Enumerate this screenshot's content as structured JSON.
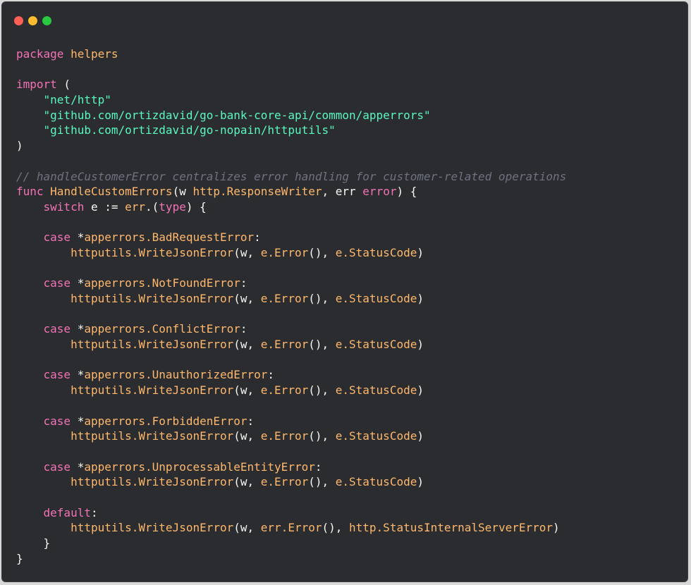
{
  "window": {
    "controls": [
      {
        "name": "close",
        "color": "#ff5f57"
      },
      {
        "name": "minimize",
        "color": "#febc2e"
      },
      {
        "name": "maximize",
        "color": "#28c840"
      }
    ]
  },
  "colors": {
    "background": "#2a2c30",
    "keyword": "#f472b6",
    "identifier": "#ffb86c",
    "string": "#5af7c2",
    "comment": "#6f7280",
    "plain": "#f8f8f2"
  },
  "code": {
    "language": "go",
    "lines": [
      [
        {
          "t": "package",
          "k": "keyword"
        },
        {
          "t": " ",
          "k": "plain"
        },
        {
          "t": "helpers",
          "k": "ident"
        }
      ],
      [],
      [
        {
          "t": "import",
          "k": "keyword"
        },
        {
          "t": " (",
          "k": "plain"
        }
      ],
      [
        {
          "t": "    ",
          "k": "plain"
        },
        {
          "t": "\"net/http\"",
          "k": "string"
        }
      ],
      [
        {
          "t": "    ",
          "k": "plain"
        },
        {
          "t": "\"github.com/ortizdavid/go-bank-core-api/common/apperrors\"",
          "k": "string"
        }
      ],
      [
        {
          "t": "    ",
          "k": "plain"
        },
        {
          "t": "\"github.com/ortizdavid/go-nopain/httputils\"",
          "k": "string"
        }
      ],
      [
        {
          "t": ")",
          "k": "plain"
        }
      ],
      [],
      [
        {
          "t": "// handleCustomerError centralizes error handling for customer-related operations",
          "k": "comment"
        }
      ],
      [
        {
          "t": "func",
          "k": "keyword"
        },
        {
          "t": " ",
          "k": "plain"
        },
        {
          "t": "HandleCustomErrors",
          "k": "ident"
        },
        {
          "t": "(w ",
          "k": "plain"
        },
        {
          "t": "http.ResponseWriter",
          "k": "ident"
        },
        {
          "t": ", err ",
          "k": "plain"
        },
        {
          "t": "error",
          "k": "keyword"
        },
        {
          "t": ") {",
          "k": "plain"
        }
      ],
      [
        {
          "t": "    ",
          "k": "plain"
        },
        {
          "t": "switch",
          "k": "keyword"
        },
        {
          "t": " e := ",
          "k": "plain"
        },
        {
          "t": "err",
          "k": "ident"
        },
        {
          "t": ".(",
          "k": "plain"
        },
        {
          "t": "type",
          "k": "keyword"
        },
        {
          "t": ") {",
          "k": "plain"
        }
      ],
      [],
      [
        {
          "t": "    ",
          "k": "plain"
        },
        {
          "t": "case",
          "k": "keyword"
        },
        {
          "t": " *",
          "k": "plain"
        },
        {
          "t": "apperrors.BadRequestError",
          "k": "ident"
        },
        {
          "t": ":",
          "k": "plain"
        }
      ],
      [
        {
          "t": "        ",
          "k": "plain"
        },
        {
          "t": "httputils.WriteJsonError",
          "k": "ident"
        },
        {
          "t": "(w, ",
          "k": "plain"
        },
        {
          "t": "e.Error",
          "k": "ident"
        },
        {
          "t": "(), ",
          "k": "plain"
        },
        {
          "t": "e.StatusCode",
          "k": "ident"
        },
        {
          "t": ")",
          "k": "plain"
        }
      ],
      [],
      [
        {
          "t": "    ",
          "k": "plain"
        },
        {
          "t": "case",
          "k": "keyword"
        },
        {
          "t": " *",
          "k": "plain"
        },
        {
          "t": "apperrors.NotFoundError",
          "k": "ident"
        },
        {
          "t": ":",
          "k": "plain"
        }
      ],
      [
        {
          "t": "        ",
          "k": "plain"
        },
        {
          "t": "httputils.WriteJsonError",
          "k": "ident"
        },
        {
          "t": "(w, ",
          "k": "plain"
        },
        {
          "t": "e.Error",
          "k": "ident"
        },
        {
          "t": "(), ",
          "k": "plain"
        },
        {
          "t": "e.StatusCode",
          "k": "ident"
        },
        {
          "t": ")",
          "k": "plain"
        }
      ],
      [],
      [
        {
          "t": "    ",
          "k": "plain"
        },
        {
          "t": "case",
          "k": "keyword"
        },
        {
          "t": " *",
          "k": "plain"
        },
        {
          "t": "apperrors.ConflictError",
          "k": "ident"
        },
        {
          "t": ":",
          "k": "plain"
        }
      ],
      [
        {
          "t": "        ",
          "k": "plain"
        },
        {
          "t": "httputils.WriteJsonError",
          "k": "ident"
        },
        {
          "t": "(w, ",
          "k": "plain"
        },
        {
          "t": "e.Error",
          "k": "ident"
        },
        {
          "t": "(), ",
          "k": "plain"
        },
        {
          "t": "e.StatusCode",
          "k": "ident"
        },
        {
          "t": ")",
          "k": "plain"
        }
      ],
      [],
      [
        {
          "t": "    ",
          "k": "plain"
        },
        {
          "t": "case",
          "k": "keyword"
        },
        {
          "t": " *",
          "k": "plain"
        },
        {
          "t": "apperrors.UnauthorizedError",
          "k": "ident"
        },
        {
          "t": ":",
          "k": "plain"
        }
      ],
      [
        {
          "t": "        ",
          "k": "plain"
        },
        {
          "t": "httputils.WriteJsonError",
          "k": "ident"
        },
        {
          "t": "(w, ",
          "k": "plain"
        },
        {
          "t": "e.Error",
          "k": "ident"
        },
        {
          "t": "(), ",
          "k": "plain"
        },
        {
          "t": "e.StatusCode",
          "k": "ident"
        },
        {
          "t": ")",
          "k": "plain"
        }
      ],
      [],
      [
        {
          "t": "    ",
          "k": "plain"
        },
        {
          "t": "case",
          "k": "keyword"
        },
        {
          "t": " *",
          "k": "plain"
        },
        {
          "t": "apperrors.ForbiddenError",
          "k": "ident"
        },
        {
          "t": ":",
          "k": "plain"
        }
      ],
      [
        {
          "t": "        ",
          "k": "plain"
        },
        {
          "t": "httputils.WriteJsonError",
          "k": "ident"
        },
        {
          "t": "(w, ",
          "k": "plain"
        },
        {
          "t": "e.Error",
          "k": "ident"
        },
        {
          "t": "(), ",
          "k": "plain"
        },
        {
          "t": "e.StatusCode",
          "k": "ident"
        },
        {
          "t": ")",
          "k": "plain"
        }
      ],
      [],
      [
        {
          "t": "    ",
          "k": "plain"
        },
        {
          "t": "case",
          "k": "keyword"
        },
        {
          "t": " *",
          "k": "plain"
        },
        {
          "t": "apperrors.UnprocessableEntityError",
          "k": "ident"
        },
        {
          "t": ":",
          "k": "plain"
        }
      ],
      [
        {
          "t": "        ",
          "k": "plain"
        },
        {
          "t": "httputils.WriteJsonError",
          "k": "ident"
        },
        {
          "t": "(w, ",
          "k": "plain"
        },
        {
          "t": "e.Error",
          "k": "ident"
        },
        {
          "t": "(), ",
          "k": "plain"
        },
        {
          "t": "e.StatusCode",
          "k": "ident"
        },
        {
          "t": ")",
          "k": "plain"
        }
      ],
      [],
      [
        {
          "t": "    ",
          "k": "plain"
        },
        {
          "t": "default",
          "k": "keyword"
        },
        {
          "t": ":",
          "k": "plain"
        }
      ],
      [
        {
          "t": "        ",
          "k": "plain"
        },
        {
          "t": "httputils.WriteJsonError",
          "k": "ident"
        },
        {
          "t": "(w, ",
          "k": "plain"
        },
        {
          "t": "err.Error",
          "k": "ident"
        },
        {
          "t": "(), ",
          "k": "plain"
        },
        {
          "t": "http.StatusInternalServerError",
          "k": "ident"
        },
        {
          "t": ")",
          "k": "plain"
        }
      ],
      [
        {
          "t": "    }",
          "k": "plain"
        }
      ],
      [
        {
          "t": "}",
          "k": "plain"
        }
      ]
    ]
  }
}
